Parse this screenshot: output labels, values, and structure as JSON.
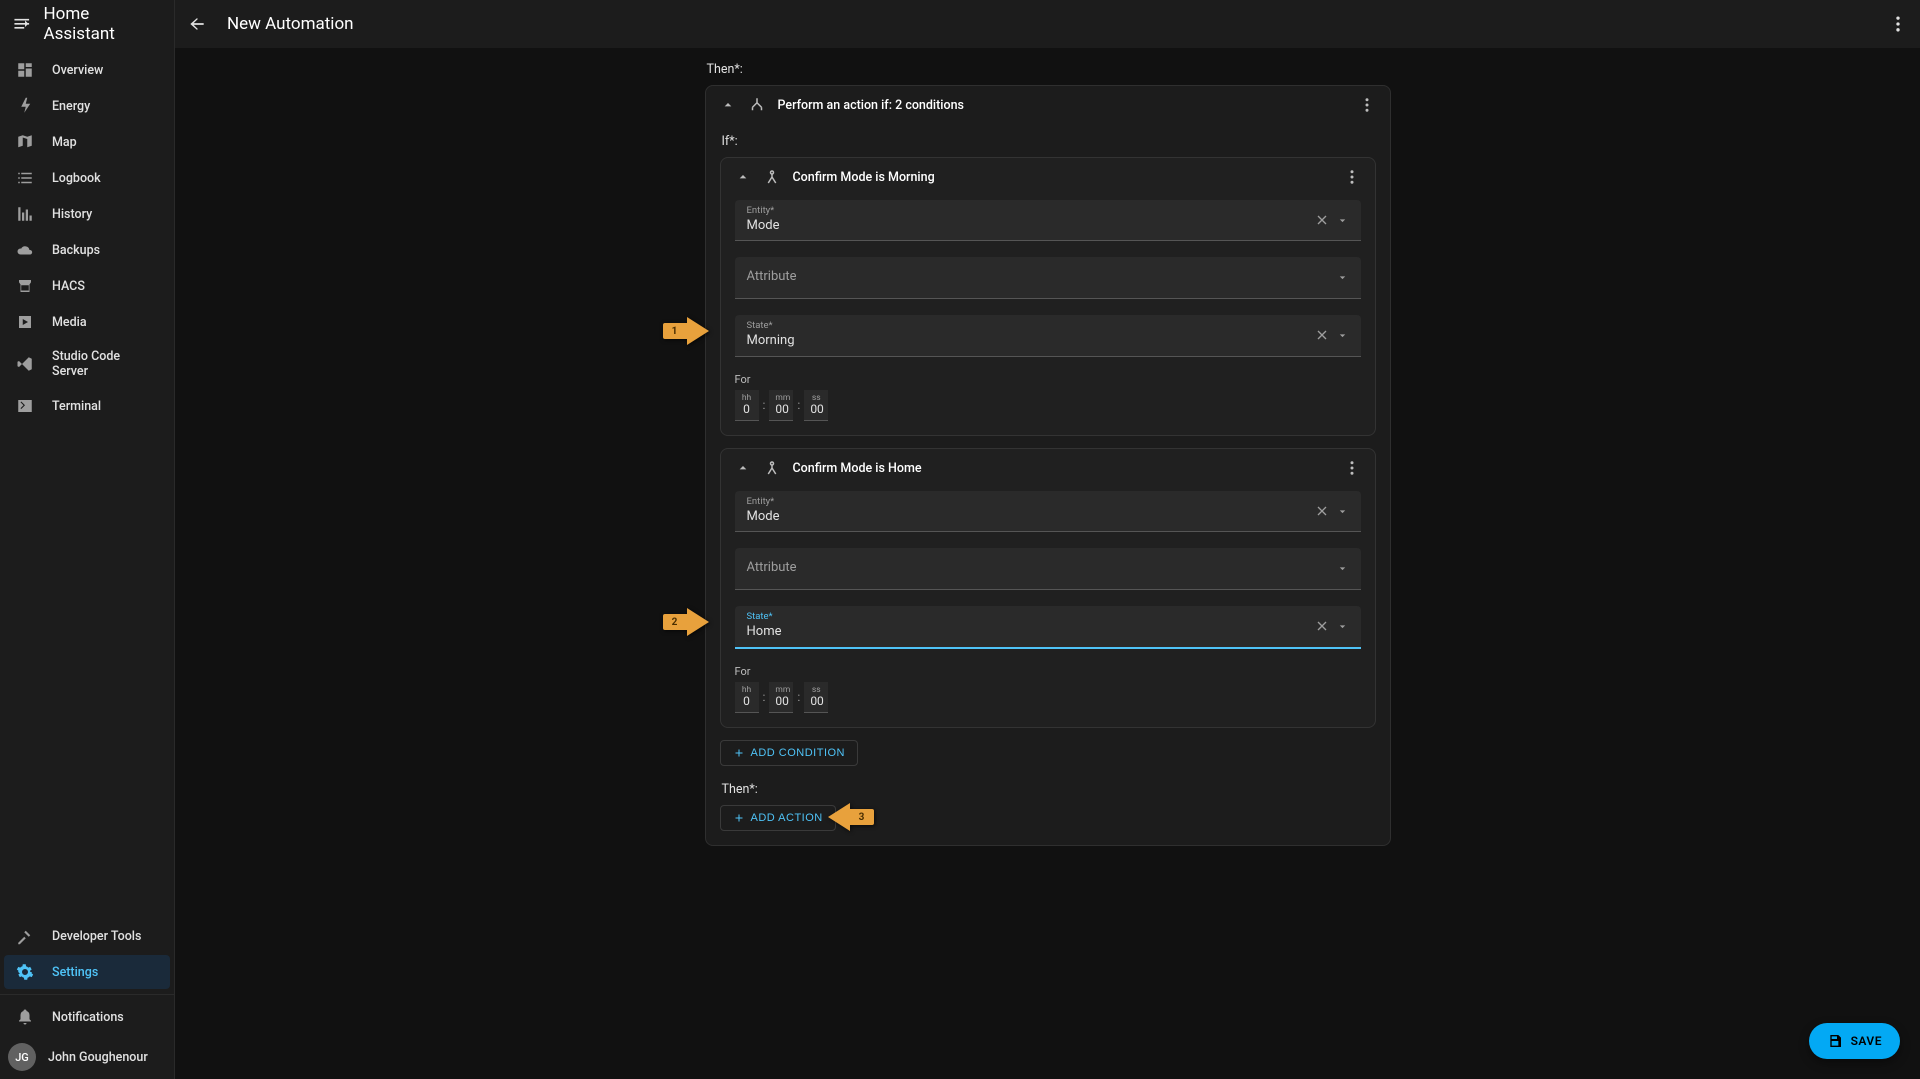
{
  "brand": "Home Assistant",
  "topbar": {
    "title": "New Automation"
  },
  "sidebar": {
    "items": [
      {
        "label": "Overview"
      },
      {
        "label": "Energy"
      },
      {
        "label": "Map"
      },
      {
        "label": "Logbook"
      },
      {
        "label": "History"
      },
      {
        "label": "Backups"
      },
      {
        "label": "HACS"
      },
      {
        "label": "Media"
      },
      {
        "label": "Studio Code Server"
      },
      {
        "label": "Terminal"
      }
    ],
    "bottom": {
      "devtools": "Developer Tools",
      "settings": "Settings",
      "notifications": "Notifications"
    }
  },
  "user": {
    "initials": "JG",
    "name": "John Goughenour"
  },
  "labels": {
    "then": "Then*:",
    "then2": "Then*:",
    "if": "If*:",
    "for": "For",
    "hh": "hh",
    "mm": "mm",
    "ss": "ss",
    "entity": "Entity*",
    "attribute": "Attribute",
    "state": "State*"
  },
  "action_card": {
    "title": "Perform an action if: 2 conditions"
  },
  "conditions": [
    {
      "title": "Confirm Mode is Morning",
      "entity": "Mode",
      "state": "Morning",
      "focused": false,
      "hh": "0",
      "mm": "00",
      "ss": "00"
    },
    {
      "title": "Confirm Mode is Home",
      "entity": "Mode",
      "state": "Home",
      "focused": true,
      "hh": "0",
      "mm": "00",
      "ss": "00"
    }
  ],
  "buttons": {
    "add_condition": "ADD CONDITION",
    "add_action": "ADD ACTION",
    "save": "SAVE"
  },
  "annotations": {
    "a1": "1",
    "a2": "2",
    "a3": "3"
  }
}
